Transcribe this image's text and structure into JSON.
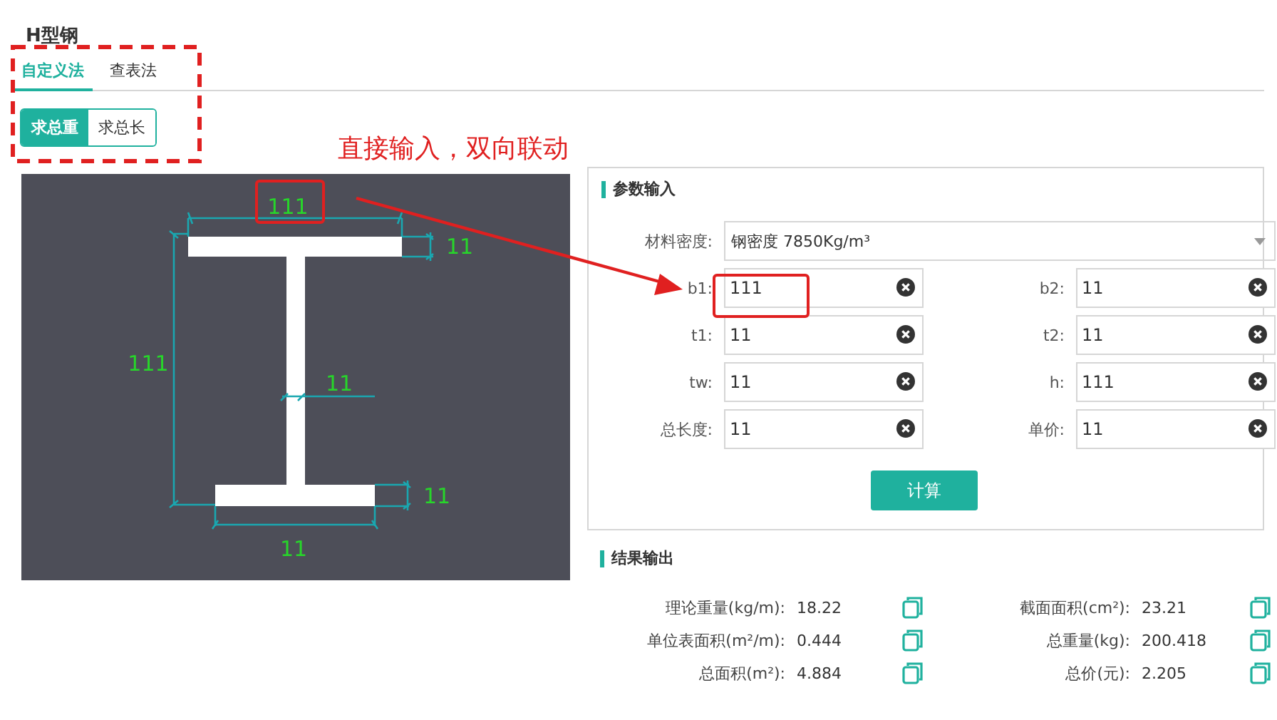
{
  "title": "H型钢",
  "tabs": [
    {
      "label": "自定义法",
      "selected": true
    },
    {
      "label": "查表法",
      "selected": false
    }
  ],
  "modes": [
    {
      "label": "求总重",
      "selected": true
    },
    {
      "label": "求总长",
      "selected": false
    }
  ],
  "annotation": "直接输入，双向联动",
  "drawing": {
    "b1": "111",
    "t1": "11",
    "h": "111",
    "tw": "11",
    "t2": "11",
    "b2": "11"
  },
  "input_section": {
    "title": "参数输入",
    "density": {
      "label": "材料密度:",
      "value": "钢密度 7850Kg/m³"
    },
    "fields": [
      {
        "label": "b1:",
        "value": "111"
      },
      {
        "label": "b2:",
        "value": "11"
      },
      {
        "label": "t1:",
        "value": "11"
      },
      {
        "label": "t2:",
        "value": "11"
      },
      {
        "label": "tw:",
        "value": "11"
      },
      {
        "label": "h:",
        "value": "111"
      },
      {
        "label": "总长度:",
        "value": "11"
      },
      {
        "label": "单价:",
        "value": "11"
      }
    ],
    "button": "计算"
  },
  "output_section": {
    "title": "结果输出",
    "results": [
      {
        "label": "理论重量(kg/m):",
        "value": "18.22"
      },
      {
        "label": "截面面积(cm²):",
        "value": "23.21"
      },
      {
        "label": "单位表面积(m²/m):",
        "value": "0.444"
      },
      {
        "label": "总重量(kg):",
        "value": "200.418"
      },
      {
        "label": "总面积(m²):",
        "value": "4.884"
      },
      {
        "label": "总价(元):",
        "value": "2.205"
      }
    ]
  }
}
